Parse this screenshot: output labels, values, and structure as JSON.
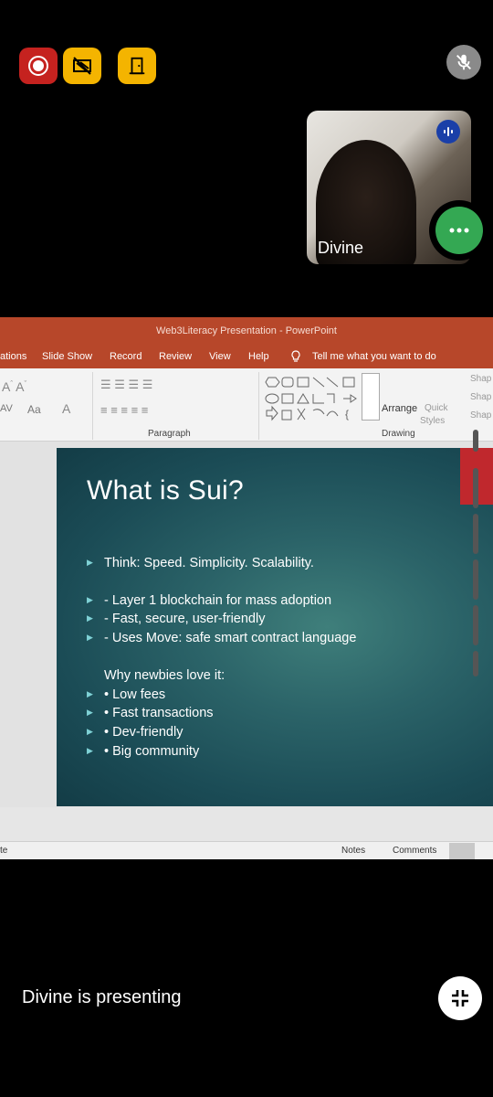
{
  "controls": {
    "record_icon": "record-icon",
    "share_off_icon": "screen-share-off-icon",
    "leave_icon": "door-icon",
    "mic_icon": "mic-off-icon"
  },
  "participant": {
    "name": "Divine"
  },
  "ppt": {
    "window_title": "Web3Literacy Presentation  -  PowerPoint",
    "tabs": [
      "ations",
      "Slide Show",
      "Record",
      "Review",
      "View",
      "Help",
      "Tell me what you want to do"
    ],
    "groups": {
      "paragraph": "Paragraph",
      "drawing": "Drawing"
    },
    "ribbon": {
      "arrange": "Arrange",
      "quick_styles_1": "Quick",
      "quick_styles_2": "Styles",
      "shape1": "Shap",
      "shape2": "Shap",
      "shape3": "Shap",
      "aa": "Aa",
      "av": "AV"
    },
    "status": {
      "left": "te",
      "notes": "Notes",
      "comments": "Comments"
    }
  },
  "slide": {
    "title": "What is Sui?",
    "bullets_top": [
      "Think: Speed. Simplicity. Scalability.",
      "- Layer 1 blockchain for mass adoption",
      "- Fast, secure, user-friendly",
      "- Uses Move: safe smart contract language"
    ],
    "why_heading": "Why newbies love it:",
    "why_bullets": [
      "• Low fees",
      "• Fast transactions",
      "• Dev-friendly",
      "• Big community"
    ]
  },
  "footer": {
    "presenting_text": "Divine is presenting",
    "exit_icon": "exit-fullscreen-icon"
  },
  "colors": {
    "record": "#c5221f",
    "share": "#f4b400",
    "more": "#34a853",
    "ppt_red": "#b7472a"
  }
}
